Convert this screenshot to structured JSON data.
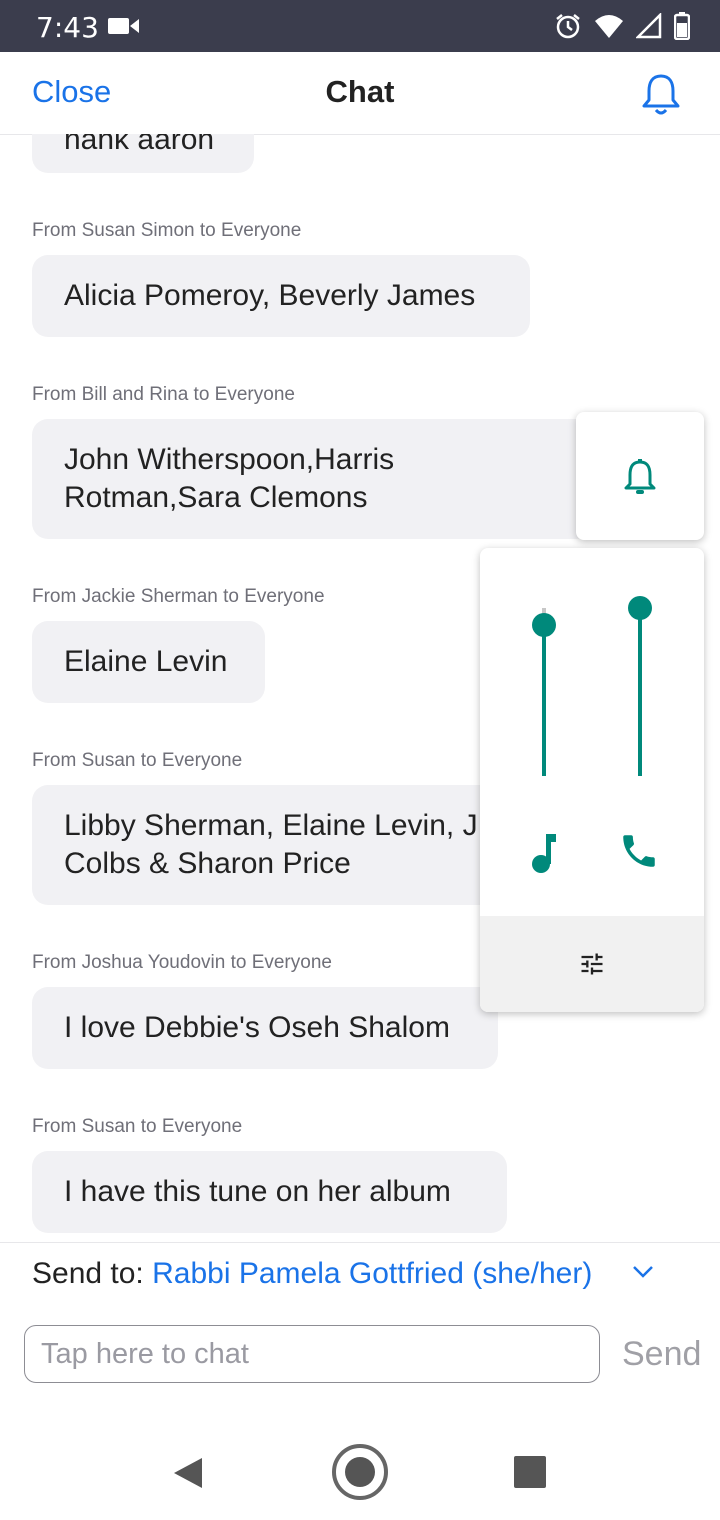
{
  "status_bar": {
    "time": "7:43",
    "icons": [
      "video-camera-icon",
      "alarm-icon",
      "wifi-icon",
      "signal-icon",
      "battery-icon"
    ]
  },
  "header": {
    "close_label": "Close",
    "title": "Chat",
    "bell_icon": "bell-icon"
  },
  "messages": [
    {
      "sender": "",
      "text": "hank aaron"
    },
    {
      "sender": "From Susan Simon to Everyone",
      "text": "Alicia Pomeroy, Beverly James"
    },
    {
      "sender": "From Bill and Rina to Everyone",
      "line1": "John Witherspoon,Harris",
      "line2": "Rotman,Sara Clemons"
    },
    {
      "sender": "From Jackie Sherman to Everyone",
      "text": "Elaine Levin"
    },
    {
      "sender": "From Susan to Everyone",
      "line1": "Libby Sherman, Elaine Levin, J",
      "line2": "Colbs & Sharon Price"
    },
    {
      "sender": "From Joshua Youdovin to Everyone",
      "text": "I love Debbie's Oseh Shalom"
    },
    {
      "sender": "From Susan to Everyone",
      "text": "I have this tune on her album"
    }
  ],
  "volume_panel": {
    "ring_icon": "bell-icon",
    "media_level": 0.9,
    "call_level": 1.0,
    "media_icon": "music-note-icon",
    "call_icon": "phone-icon",
    "settings_icon": "tune-icon"
  },
  "composer": {
    "send_to_label": "Send to:",
    "recipient": "Rabbi Pamela Gottfried (she/her)",
    "placeholder": "Tap here to chat",
    "value": "",
    "send_label": "Send"
  },
  "nav_bar": {
    "back_icon": "back-triangle-icon",
    "home_icon": "home-circle-icon",
    "recents_icon": "recents-square-icon"
  },
  "colors": {
    "accent": "#1a73e8",
    "teal": "#00897b",
    "status_bar": "#3b3d4d",
    "bubble": "#f1f1f4"
  }
}
